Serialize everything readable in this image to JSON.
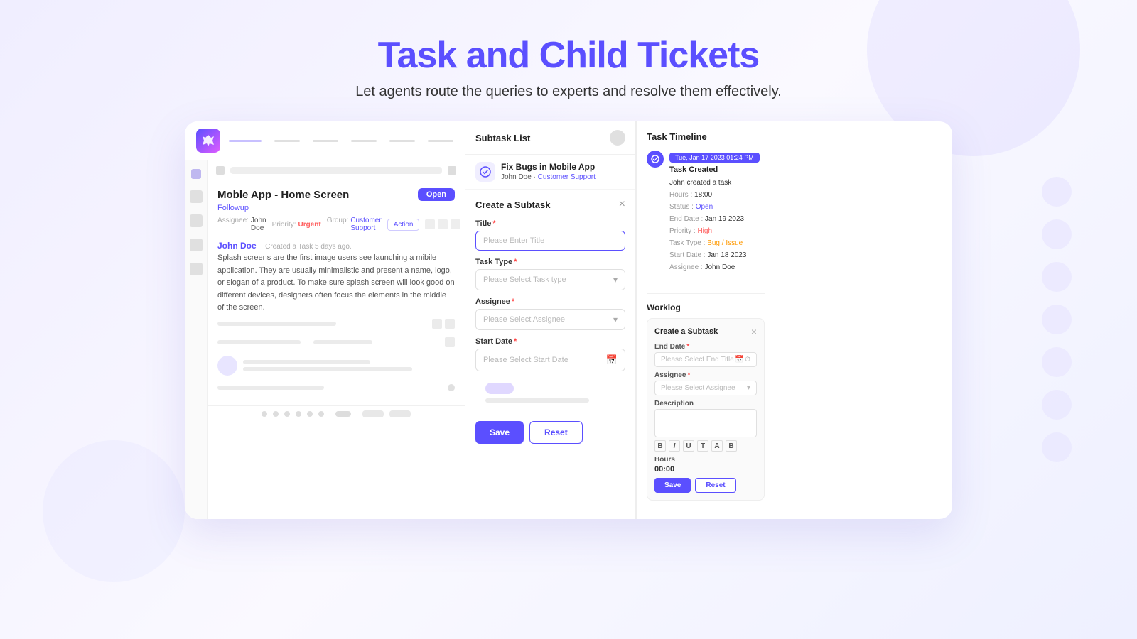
{
  "page": {
    "title": "Task and Child Tickets",
    "subtitle": "Let agents route the queries to experts and resolve them effectively."
  },
  "navbar": {
    "nav_lines": [
      "active",
      "normal",
      "normal",
      "normal",
      "normal",
      "normal",
      "normal"
    ],
    "avatar_colors": [
      "gray",
      "purple",
      "gray",
      "dark"
    ]
  },
  "ticket": {
    "title": "Moble App - Home Screen",
    "tag": "Followup",
    "status": "Open",
    "assignee": "John Doe",
    "priority": "Urgent",
    "group": "Customer Support",
    "action_label": "Action",
    "author": "John Doe",
    "created_time": "Created a Task 5 days ago.",
    "comment": "Splash screens are the first image users see launching a mibile application. They are usually minimalistic and present a name, logo, or slogan of a product. To make sure splash screen will look good on different devices, designers often focus the elements in the middle of the screen."
  },
  "subtask_list": {
    "header": "Subtask List",
    "items": [
      {
        "title": "Fix Bugs in Mobile App",
        "person": "John Doe",
        "dept": "Customer Support"
      }
    ]
  },
  "create_subtask": {
    "form_title": "Create a Subtask",
    "title_label": "Title",
    "title_placeholder": "Please Enter Title",
    "task_type_label": "Task Type",
    "task_type_placeholder": "Please Select Task type",
    "assignee_label": "Assignee",
    "assignee_placeholder": "Please Select Assignee",
    "start_date_label": "Start Date",
    "start_date_placeholder": "Please Select Start Date",
    "save_btn": "Save",
    "reset_btn": "Reset"
  },
  "timeline": {
    "title": "Task Timeline",
    "date_badge": "Tue, Jan 17 2023  01:24 PM",
    "event": "Task Created",
    "created_by": "John created a task",
    "details": {
      "hours_label": "Hours",
      "hours_val": "18:00",
      "status_label": "Status",
      "status_val": "Open",
      "end_date_label": "End Date",
      "end_date_val": "Jan 19 2023",
      "priority_label": "Priority",
      "priority_val": "High",
      "task_type_label": "Task Type",
      "task_type_val": "Bug / Issue",
      "start_date_label": "Start Date",
      "start_date_val": "Jan 18 2023",
      "assignee_label": "Assignee",
      "assignee_val": "John Doe"
    }
  },
  "worklog": {
    "title": "Worklog",
    "card_title": "Create a Subtask",
    "end_date_label": "End Date",
    "end_date_placeholder": "Please Select End Title",
    "assignee_label": "Assignee",
    "assignee_placeholder": "Please Select Assignee",
    "description_label": "Description",
    "toolbar_buttons": [
      "B",
      "I",
      "U",
      "T̲",
      "A",
      "B"
    ],
    "hours_label": "Hours",
    "hours_value": "00:00",
    "save_btn": "Save",
    "reset_btn": "Reset"
  }
}
